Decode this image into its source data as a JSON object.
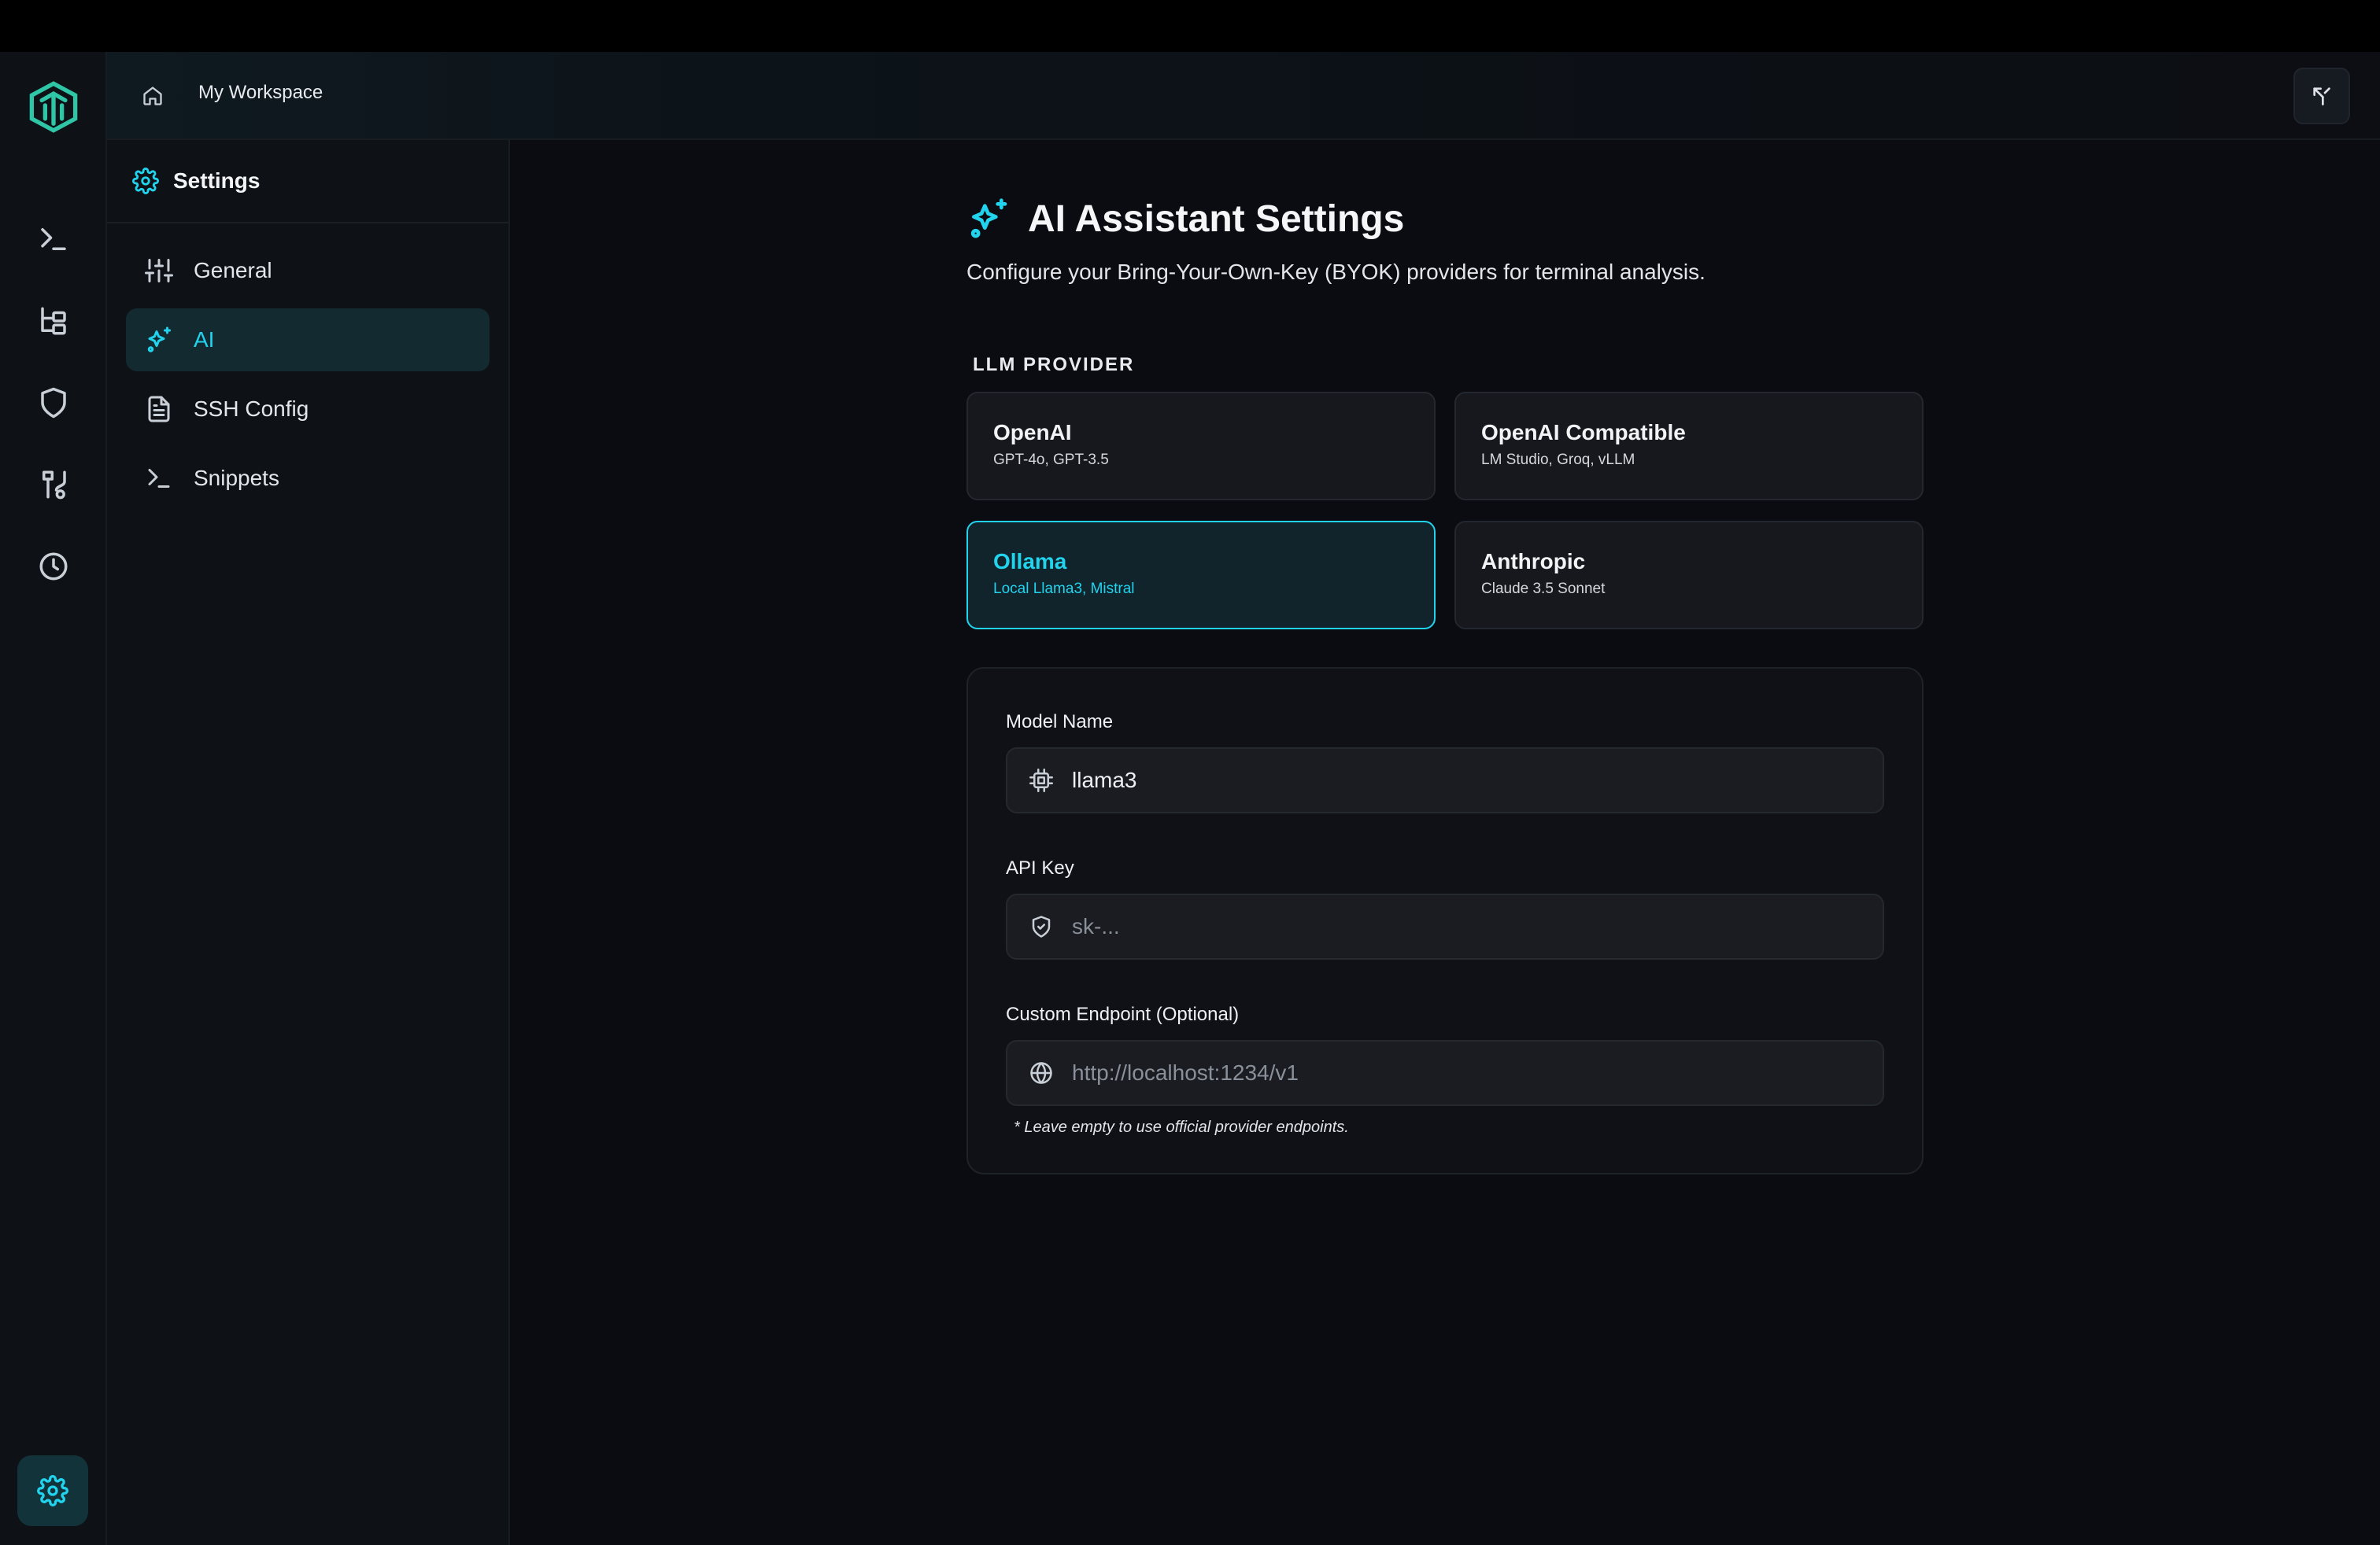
{
  "header": {
    "workspace": "My Workspace"
  },
  "sidepanel": {
    "title": "Settings",
    "items": [
      {
        "label": "General",
        "icon": "sliders-icon",
        "active": false
      },
      {
        "label": "AI",
        "icon": "sparkles-icon",
        "active": true
      },
      {
        "label": "SSH Config",
        "icon": "file-text-icon",
        "active": false
      },
      {
        "label": "Snippets",
        "icon": "terminal-icon",
        "active": false
      }
    ]
  },
  "rail": {
    "icons": [
      "terminal-icon",
      "file-tree-icon",
      "shield-icon",
      "route-icon",
      "clock-icon"
    ],
    "bottom_icon": "gear-icon"
  },
  "page": {
    "title": "AI Assistant Settings",
    "subtitle": "Configure your Bring-Your-Own-Key (BYOK) providers for terminal analysis.",
    "provider_section_label": "LLM PROVIDER",
    "providers": [
      {
        "name": "OpenAI",
        "desc": "GPT-4o, GPT-3.5",
        "selected": false
      },
      {
        "name": "OpenAI Compatible",
        "desc": "LM Studio, Groq, vLLM",
        "selected": false
      },
      {
        "name": "Ollama",
        "desc": "Local Llama3, Mistral",
        "selected": true
      },
      {
        "name": "Anthropic",
        "desc": "Claude 3.5 Sonnet",
        "selected": false
      }
    ],
    "form": {
      "model_label": "Model Name",
      "model_value": "llama3",
      "api_key_label": "API Key",
      "api_key_placeholder": "sk-...",
      "endpoint_label": "Custom Endpoint (Optional)",
      "endpoint_placeholder": "http://localhost:1234/v1",
      "note": "* Leave empty to use official provider endpoints."
    }
  },
  "colors": {
    "accent": "#22d3ee",
    "background": "#0b0c11",
    "panel": "#0e1116"
  }
}
